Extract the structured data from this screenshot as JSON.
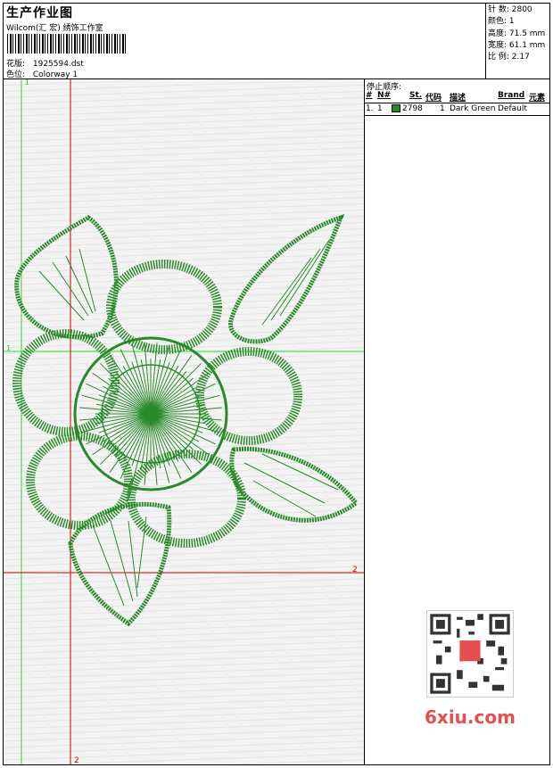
{
  "header": {
    "title": "生产作业图",
    "company": "Wilcom(汇 宏) 绣饰工作室",
    "design_label": "花版:",
    "design_file": "1925594.dst",
    "colorway_label": "色位:",
    "colorway": "Colorway 1"
  },
  "stats": {
    "stitches": "针 数: 2800",
    "colors": "颜色: 1",
    "height": "高度: 71.5 mm",
    "width": "宽度: 61.1 mm",
    "scale": "比 例: 2.17"
  },
  "guides": {
    "green_top": "1",
    "green_left": "1",
    "red_right": "2",
    "red_bottom": "2"
  },
  "stop_sequence": {
    "title": "停止顺序:",
    "columns": [
      "#",
      "N#",
      "St.",
      "代码",
      "描述",
      "Brand",
      "元素"
    ],
    "rows": [
      {
        "num": "1.",
        "needle": "1",
        "stitches": "2798",
        "code": "1",
        "description": "Dark Green",
        "brand": "Default",
        "color": "#2a8a2a"
      }
    ]
  },
  "watermark": {
    "text": "6xiu.com"
  },
  "colors": {
    "thread": "#2a8a2a",
    "green_guide": "#2fd42f",
    "red_guide": "#cc0000"
  }
}
